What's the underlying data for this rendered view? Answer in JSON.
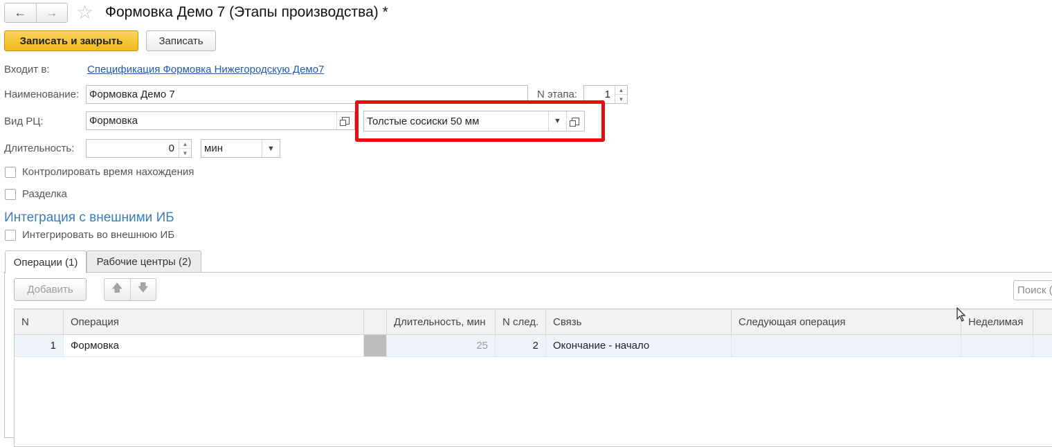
{
  "window": {
    "title": "Формовка Демо 7 (Этапы производства) *",
    "nav_back": "←",
    "nav_forward": "→",
    "favorite_icon": "star-icon"
  },
  "toolbar": {
    "save_close_label": "Записать и закрыть",
    "save_label": "Записать"
  },
  "form": {
    "parent_label": "Входит в:",
    "parent_link": "Спецификация Формовка Нижегородскую  Демо7",
    "name_label": "Наименование:",
    "name_value": "Формовка Демо 7",
    "stage_no_label": "N этапа:",
    "stage_no_value": "1",
    "wc_type_label": "Вид РЦ:",
    "wc_type_value": "Формовка",
    "product_value": "Толстые сосиски 50 мм",
    "duration_label": "Длительность:",
    "duration_value": "0",
    "duration_unit": "мин",
    "control_time_label": "Контролировать время нахождения",
    "cutting_label": "Разделка"
  },
  "integration": {
    "section_title": "Интеграция с внешними ИБ",
    "integrate_label": "Интегрировать во внешнюю ИБ"
  },
  "tabs": [
    {
      "label": "Операции (1)",
      "active": true
    },
    {
      "label": "Рабочие центры (2)",
      "active": false
    }
  ],
  "operations": {
    "add_label": "Добавить",
    "search_placeholder": "Поиск (",
    "columns": [
      "N",
      "Операция",
      "",
      "Длительность, мин",
      "N след.",
      "Связь",
      "Следующая операция",
      "Неделимая"
    ],
    "rows": [
      {
        "n": "1",
        "operation": "Формовка",
        "duration": "25",
        "next_n": "2",
        "link": "Окончание - начало",
        "next_op": "",
        "indivisible": ""
      }
    ]
  },
  "colors": {
    "primary_button": "#f0b719",
    "highlight_frame": "#ea0d0d",
    "section_title": "#3a7cb9",
    "link": "#1e5ea8"
  }
}
